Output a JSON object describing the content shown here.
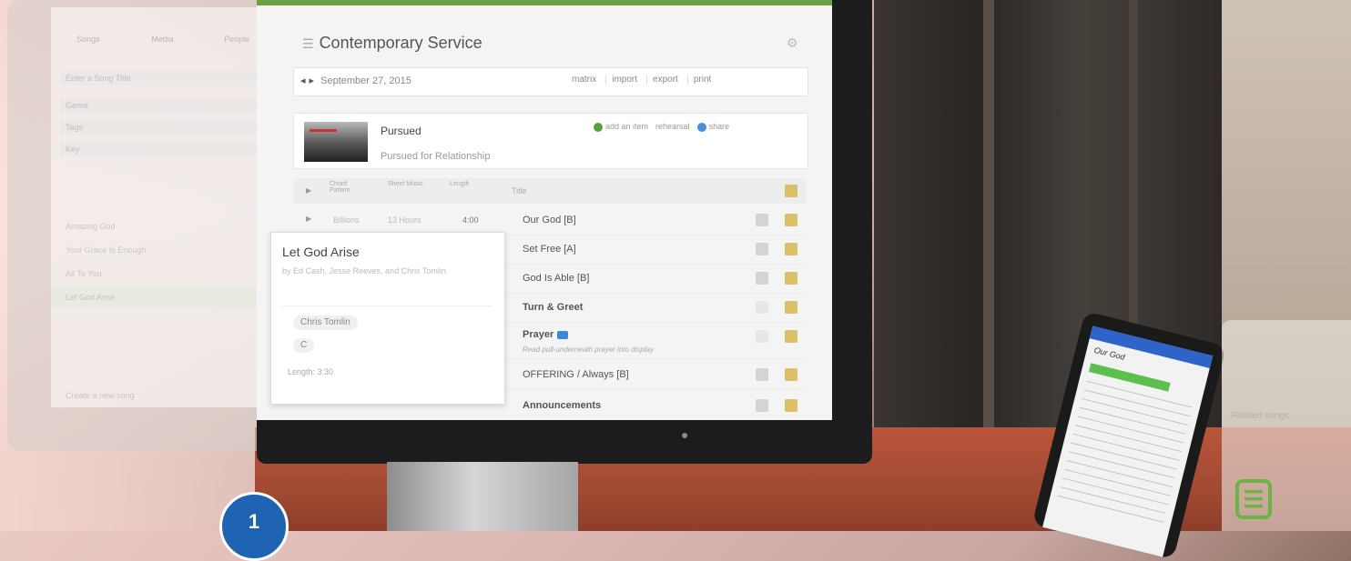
{
  "app": {
    "service_title": "Contemporary Service",
    "date": "September 27, 2015",
    "toolbar": {
      "matrix": "matrix",
      "import": "import",
      "export": "export",
      "print": "print"
    }
  },
  "song": {
    "title": "Pursued",
    "subtitle": "Pursued for Relationship",
    "actions": {
      "add_item": "add an item",
      "rehearse": "rehearsal",
      "share": "share"
    }
  },
  "table": {
    "header": {
      "col1": "Chord Pattern",
      "col2": "Sheet Music",
      "col3": "Length",
      "title": "Title"
    },
    "rows": [
      {
        "left": "Billions",
        "mid": "13 Hours",
        "len": "4:00",
        "title": "Our God [B]",
        "note": ""
      },
      {
        "left": "",
        "mid": "",
        "len": "",
        "title": "Set Free [A]",
        "note": ""
      },
      {
        "left": "",
        "mid": "",
        "len": "",
        "title": "God Is Able [B]",
        "note": ""
      },
      {
        "left": "",
        "mid": "",
        "len": "",
        "title": "Turn & Greet",
        "note": ""
      },
      {
        "left": "",
        "mid": "",
        "len": "",
        "title": "Prayer",
        "note": "Read pull-underneath prayer into display"
      },
      {
        "left": "",
        "mid": "",
        "len": "",
        "title": "OFFERING / Always [B]",
        "note": ""
      },
      {
        "left": "",
        "mid": "",
        "len": "",
        "title": "Announcements",
        "note": ""
      }
    ]
  },
  "popup": {
    "title": "Let God Arise",
    "by": "by Ed Cash, Jesse Reeves, and Chris Tomlin",
    "artist_chip": "Chris Tomlin",
    "key_chip": "C",
    "length": "Length: 3:30"
  },
  "ghost_panel": {
    "tabs": [
      "Songs",
      "Media",
      "People"
    ],
    "search_placeholder": "Enter a Song Title",
    "fields": [
      "Genre",
      "Tags",
      "Key"
    ],
    "songs": [
      "Amazing God",
      "Your Grace Is Enough",
      "All To You",
      "Let God Arise"
    ],
    "footer": "Create a new song"
  },
  "tablet": {
    "title": "Our God"
  },
  "ghost_tablet": {
    "text": "Related songs"
  },
  "overlay": {
    "step_number": "1"
  },
  "icons": {
    "doc": "document-list-icon",
    "gear": "gear-icon"
  },
  "colors": {
    "accent": "#1f63b3",
    "green": "#5aa13e",
    "doc_icon": "#6ab446"
  }
}
